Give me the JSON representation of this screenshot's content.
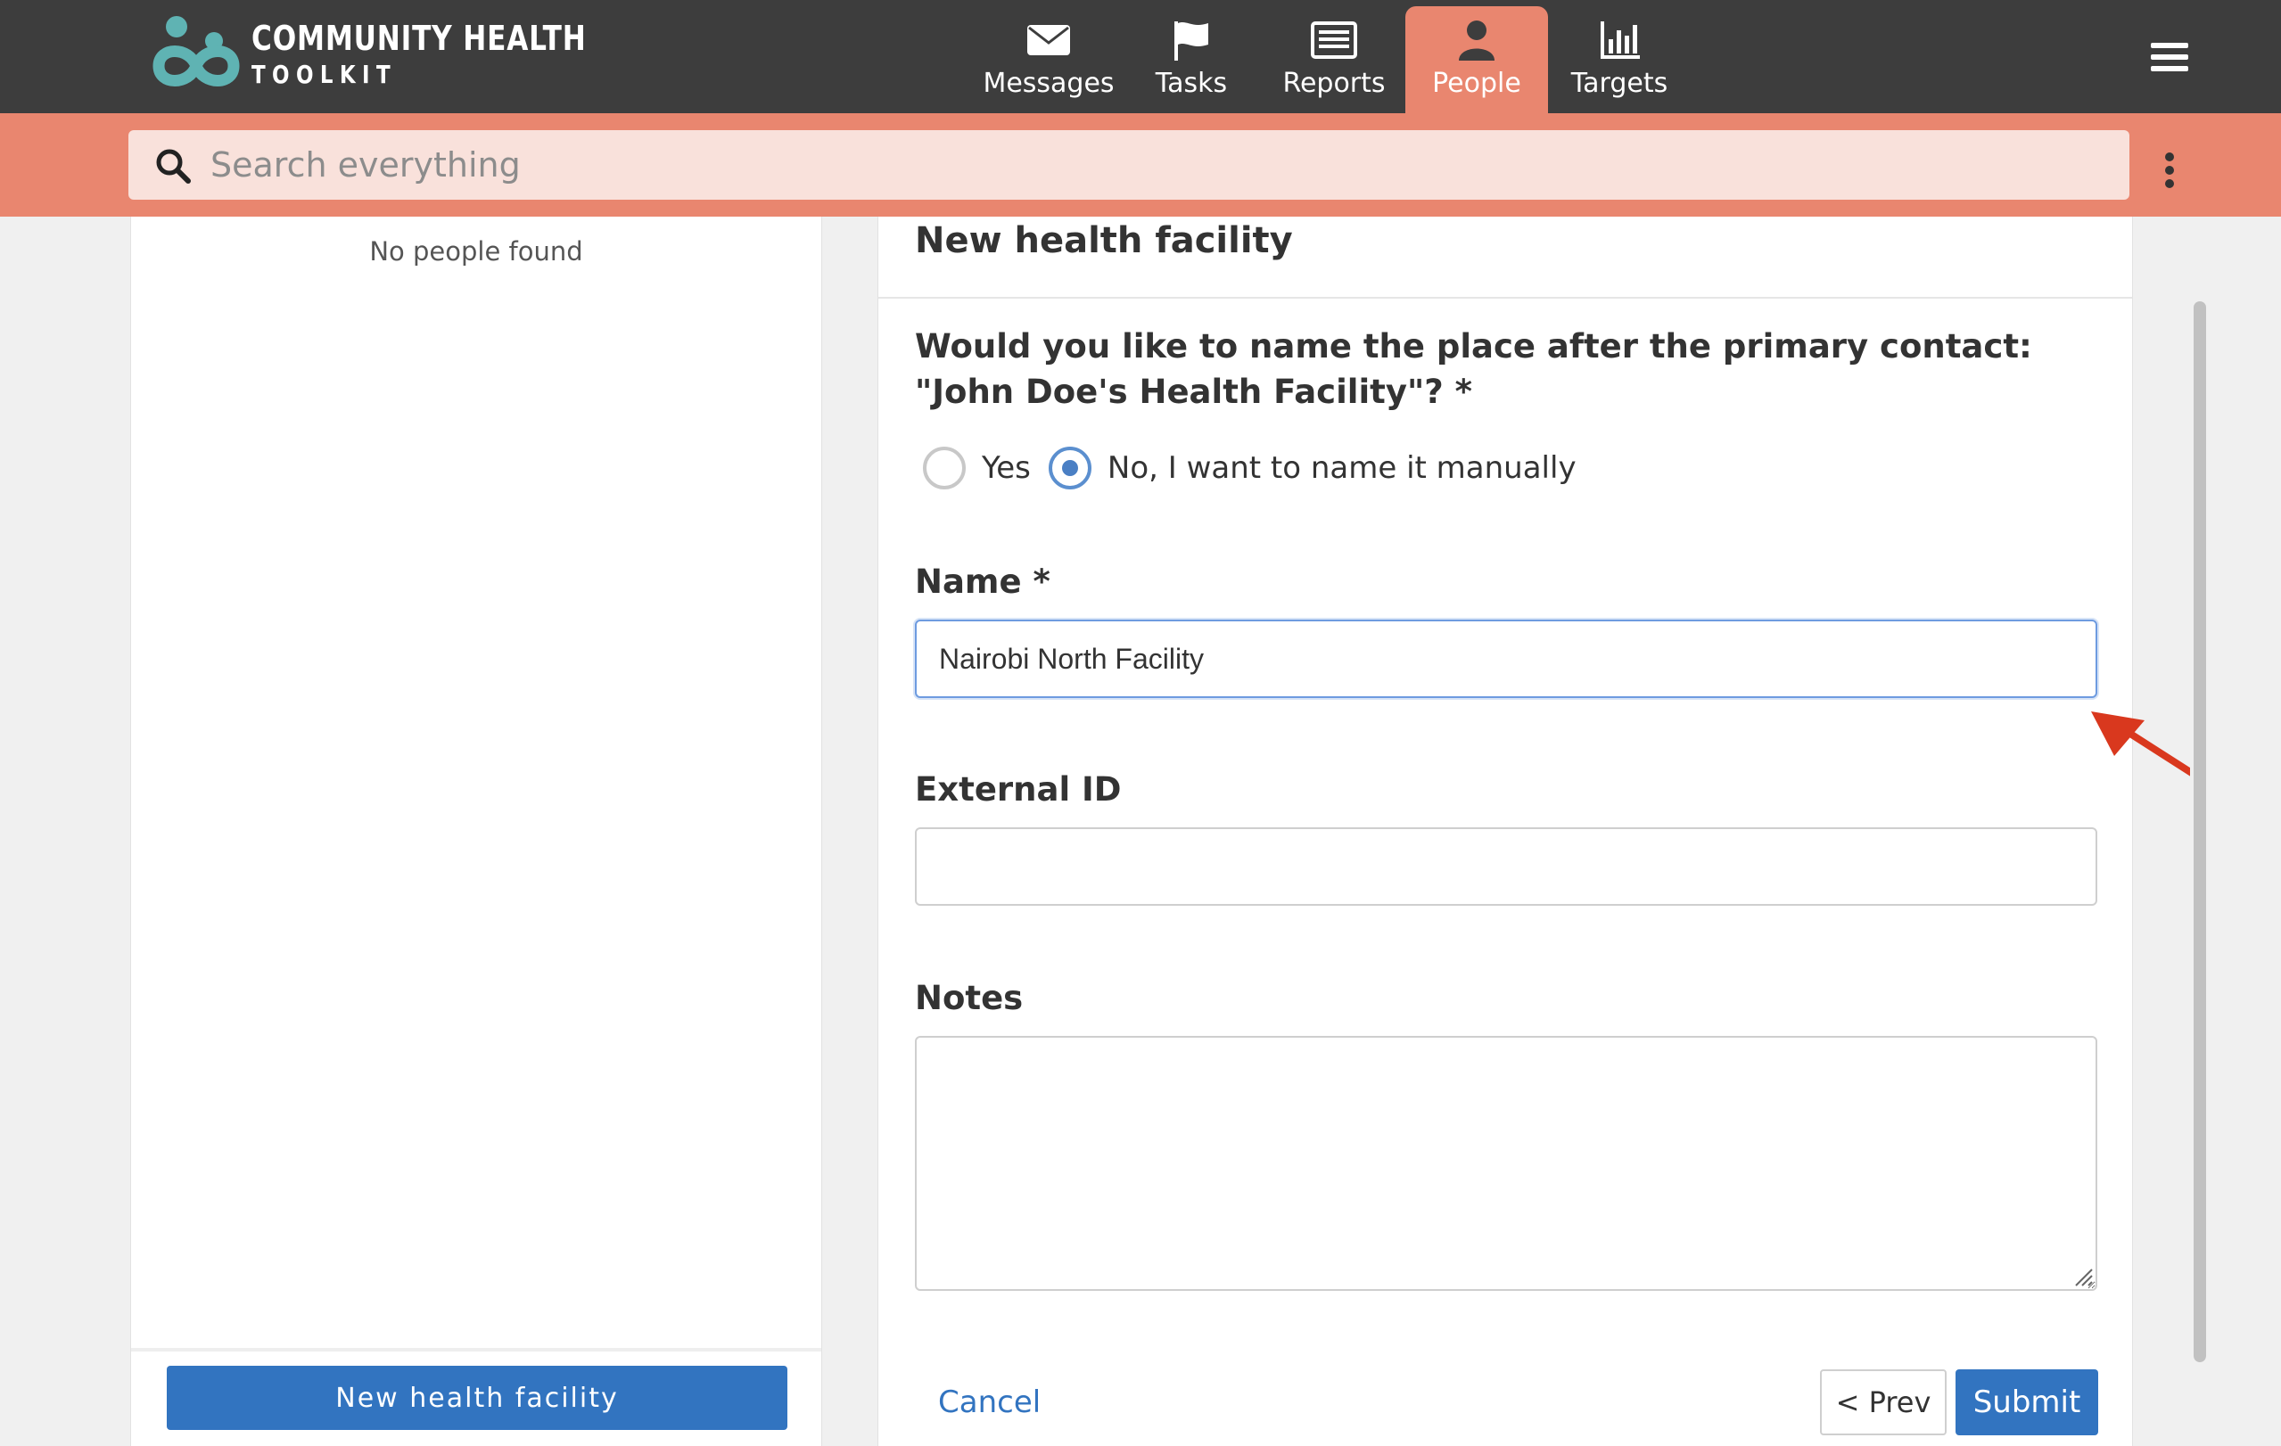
{
  "app": {
    "logo_line1": "COMMUNITY HEALTH",
    "logo_line2": "TOOLKIT"
  },
  "nav": {
    "items": [
      {
        "label": "Messages",
        "icon": "envelope-icon",
        "active": false
      },
      {
        "label": "Tasks",
        "icon": "flag-icon",
        "active": false
      },
      {
        "label": "Reports",
        "icon": "list-icon",
        "active": false
      },
      {
        "label": "People",
        "icon": "person-icon",
        "active": true
      },
      {
        "label": "Targets",
        "icon": "bar-chart-icon",
        "active": false
      }
    ]
  },
  "search": {
    "placeholder": "Search everything",
    "value": ""
  },
  "left_panel": {
    "empty_message": "No people found",
    "new_button_label": "New health facility"
  },
  "form": {
    "title": "New health facility",
    "question": "Would you like to name the place after the primary contact: \"John Doe's Health Facility\"? *",
    "options": [
      {
        "label": "Yes",
        "checked": false
      },
      {
        "label": "No, I want to name it manually",
        "checked": true
      }
    ],
    "name_label": "Name *",
    "name_value": "Nairobi North Facility",
    "external_id_label": "External ID",
    "external_id_value": "",
    "notes_label": "Notes",
    "notes_value": "",
    "cancel_label": "Cancel",
    "prev_label": "< Prev",
    "submit_label": "Submit"
  },
  "colors": {
    "topbar": "#3d3d3d",
    "accent": "#e9866f",
    "search_bg": "#f9e1db",
    "primary_button": "#3274c0",
    "annotation_arrow": "#d9381e"
  }
}
